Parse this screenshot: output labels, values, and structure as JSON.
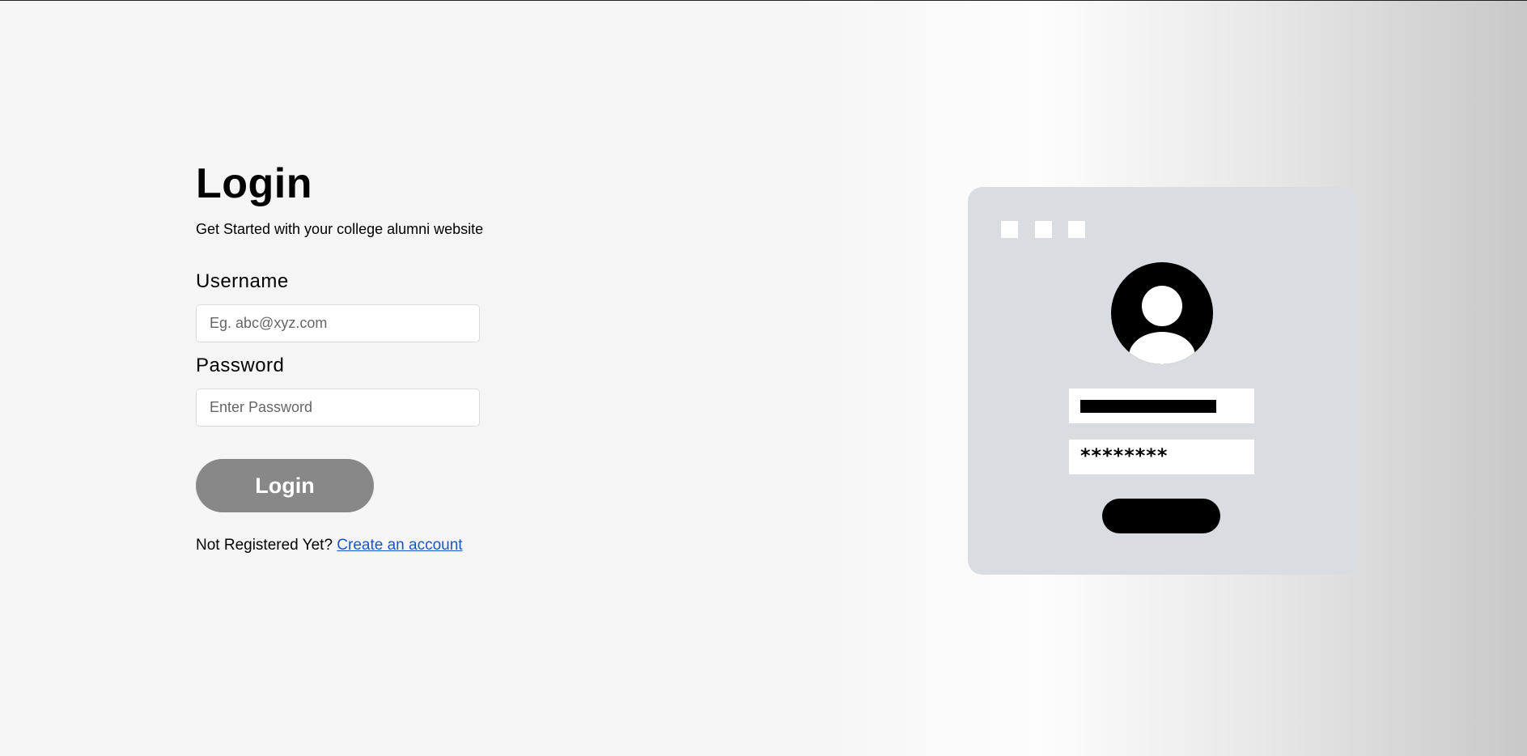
{
  "login": {
    "title": "Login",
    "subtitle": "Get Started with your college alumni website",
    "username_label": "Username",
    "username_placeholder": "Eg. abc@xyz.com",
    "password_label": "Password",
    "password_placeholder": "Enter Password",
    "button_label": "Login",
    "register_text": "Not Registered Yet?",
    "register_link": "Create an account"
  },
  "illustration": {
    "password_mask": "********",
    "icons": [
      "window-square-icon",
      "user-avatar-icon"
    ]
  },
  "colors": {
    "button_bg": "#888888",
    "link": "#1a56c8",
    "illustration_bg": "#d9dce0"
  }
}
